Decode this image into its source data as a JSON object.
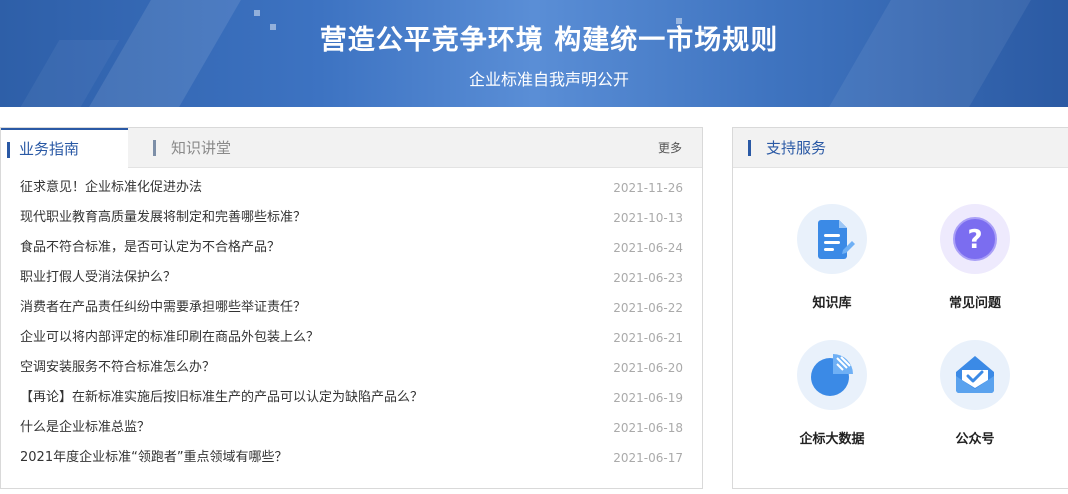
{
  "banner": {
    "title": "营造公平竞争环境  构建统一市场规则",
    "subtitle": "企业标准自我声明公开"
  },
  "tabs": {
    "active_label": "业务指南",
    "inactive_label": "知识讲堂",
    "more_label": "更多"
  },
  "news": [
    {
      "title": "征求意见！企业标准化促进办法",
      "date": "2021-11-26"
    },
    {
      "title": "现代职业教育高质量发展将制定和完善哪些标准？",
      "date": "2021-10-13"
    },
    {
      "title": "食品不符合标准，是否可认定为不合格产品？",
      "date": "2021-06-24"
    },
    {
      "title": "职业打假人受消法保护么？",
      "date": "2021-06-23"
    },
    {
      "title": "消费者在产品责任纠纷中需要承担哪些举证责任？",
      "date": "2021-06-22"
    },
    {
      "title": "企业可以将内部评定的标准印刷在商品外包装上么？",
      "date": "2021-06-21"
    },
    {
      "title": "空调安装服务不符合标准怎么办？",
      "date": "2021-06-20"
    },
    {
      "title": "【再论】在新标准实施后按旧标准生产的产品可以认定为缺陷产品么？",
      "date": "2021-06-19"
    },
    {
      "title": "什么是企业标准总监？",
      "date": "2021-06-18"
    },
    {
      "title": "2021年度企业标准“领跑者”重点领域有哪些？",
      "date": "2021-06-17"
    }
  ],
  "support": {
    "title": "支持服务",
    "items": [
      {
        "label": "知识库",
        "icon": "document-icon"
      },
      {
        "label": "常见问题",
        "icon": "question-icon"
      },
      {
        "label": "企标大数据",
        "icon": "pie-chart-icon"
      },
      {
        "label": "公众号",
        "icon": "envelope-icon"
      }
    ]
  },
  "colors": {
    "accent": "#2a59a5",
    "banner_blue": "#3d73c2",
    "icon_blue": "#3b8ae6",
    "icon_purple": "#7b6df0"
  }
}
